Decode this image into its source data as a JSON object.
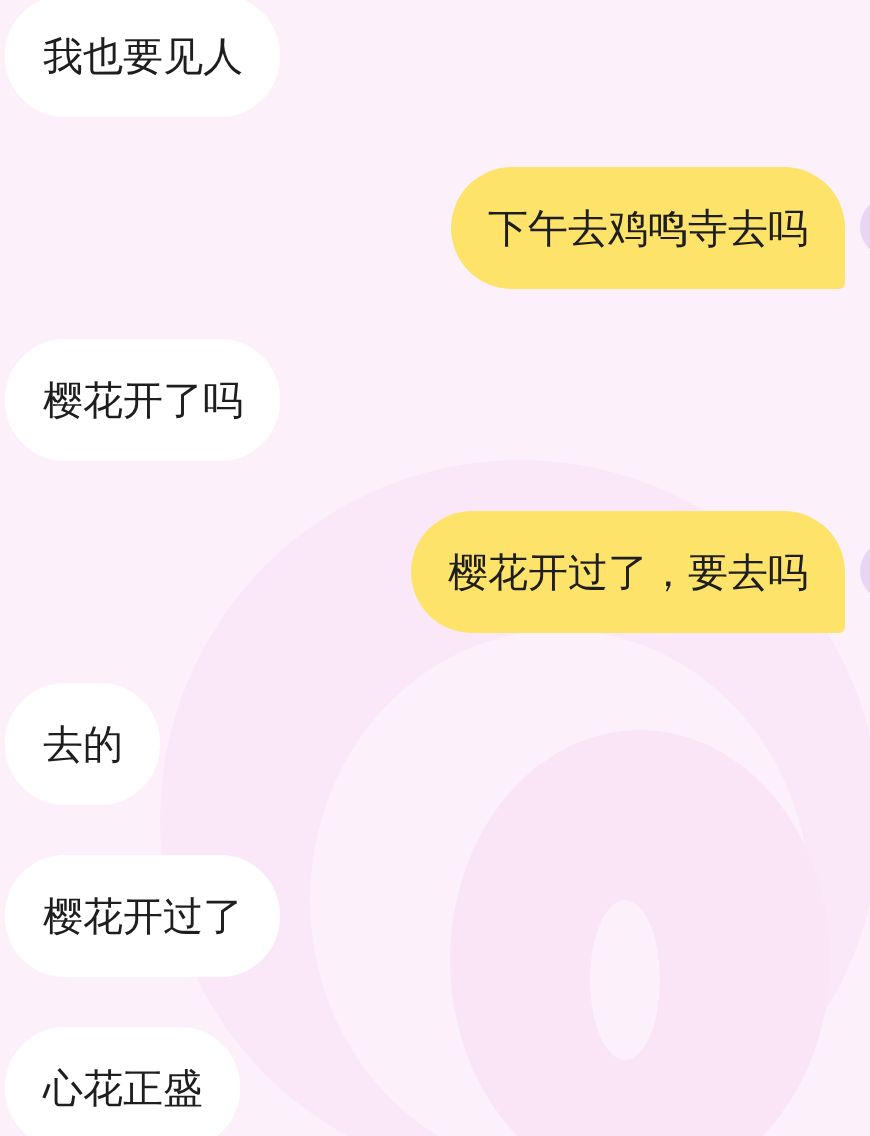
{
  "messages": [
    {
      "kind": "received",
      "text": "我也要见人"
    },
    {
      "kind": "sent",
      "text": "下午去鸡鸣寺去吗"
    },
    {
      "kind": "received",
      "text": "樱花开了吗"
    },
    {
      "kind": "sent",
      "text": "樱花开过了，要去吗"
    },
    {
      "kind": "received",
      "text": "去的"
    },
    {
      "kind": "received",
      "text": "樱花开过了"
    },
    {
      "kind": "received",
      "text": "心花正盛"
    }
  ]
}
